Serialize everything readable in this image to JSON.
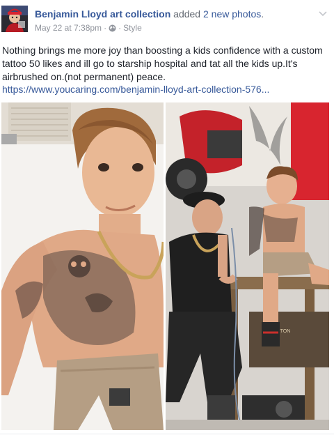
{
  "post": {
    "author": "Benjamin Lloyd art collection",
    "action_text": "added",
    "photo_count_text": "2 new photos",
    "period": ".",
    "date": "May 22 at 7:38pm",
    "separator": "·",
    "audience_icon": "globe-icon",
    "category": "Style",
    "menu_icon": "chevron-down-icon",
    "body": "Nothing brings me more joy than boosting a kids confidence with a custom tattoo 50 likes and ill go to starship hospital and tat all the kids up.It's airbrushed on.(not permanent) peace.",
    "link": "https://www.youcaring.com/benjamin-lloyd-art-collection-576..."
  },
  "photos": [
    {
      "name": "photo-child-with-tattoo",
      "description_icon": "photo"
    },
    {
      "name": "photo-artist-airbrushing",
      "description_icon": "photo"
    }
  ],
  "colors": {
    "link_blue": "#365899",
    "meta_gray": "#90949c",
    "text": "#1d2129",
    "motorcycle_red": "#d8252f"
  }
}
